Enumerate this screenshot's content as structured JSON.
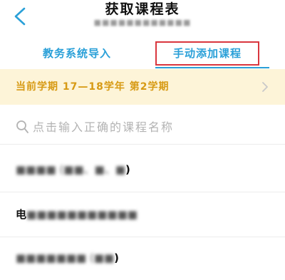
{
  "header": {
    "title": "获取课程表",
    "subtitle": "■■■■■■■■■■■■"
  },
  "tabs": [
    {
      "label": "教务系统导入"
    },
    {
      "label": "手动添加课程"
    }
  ],
  "semester": {
    "label": "当前学期  17—18学年  第2学期"
  },
  "search": {
    "placeholder": "点击输入正确的课程名称"
  },
  "courses": [
    {
      "prefix": "",
      "blurred": "■■■■ (■■、■、■",
      "suffix": ")"
    },
    {
      "prefix": "电",
      "blurred": "■■■■■■■■■■■",
      "suffix": ""
    },
    {
      "prefix": "",
      "blurred": "■■■■■■■ (■■",
      "suffix": ")"
    }
  ],
  "colors": {
    "accent": "#2aa0d8",
    "highlight_border": "#d9363e",
    "semester_bg": "#fdf4d8",
    "semester_text": "#d79a14"
  }
}
